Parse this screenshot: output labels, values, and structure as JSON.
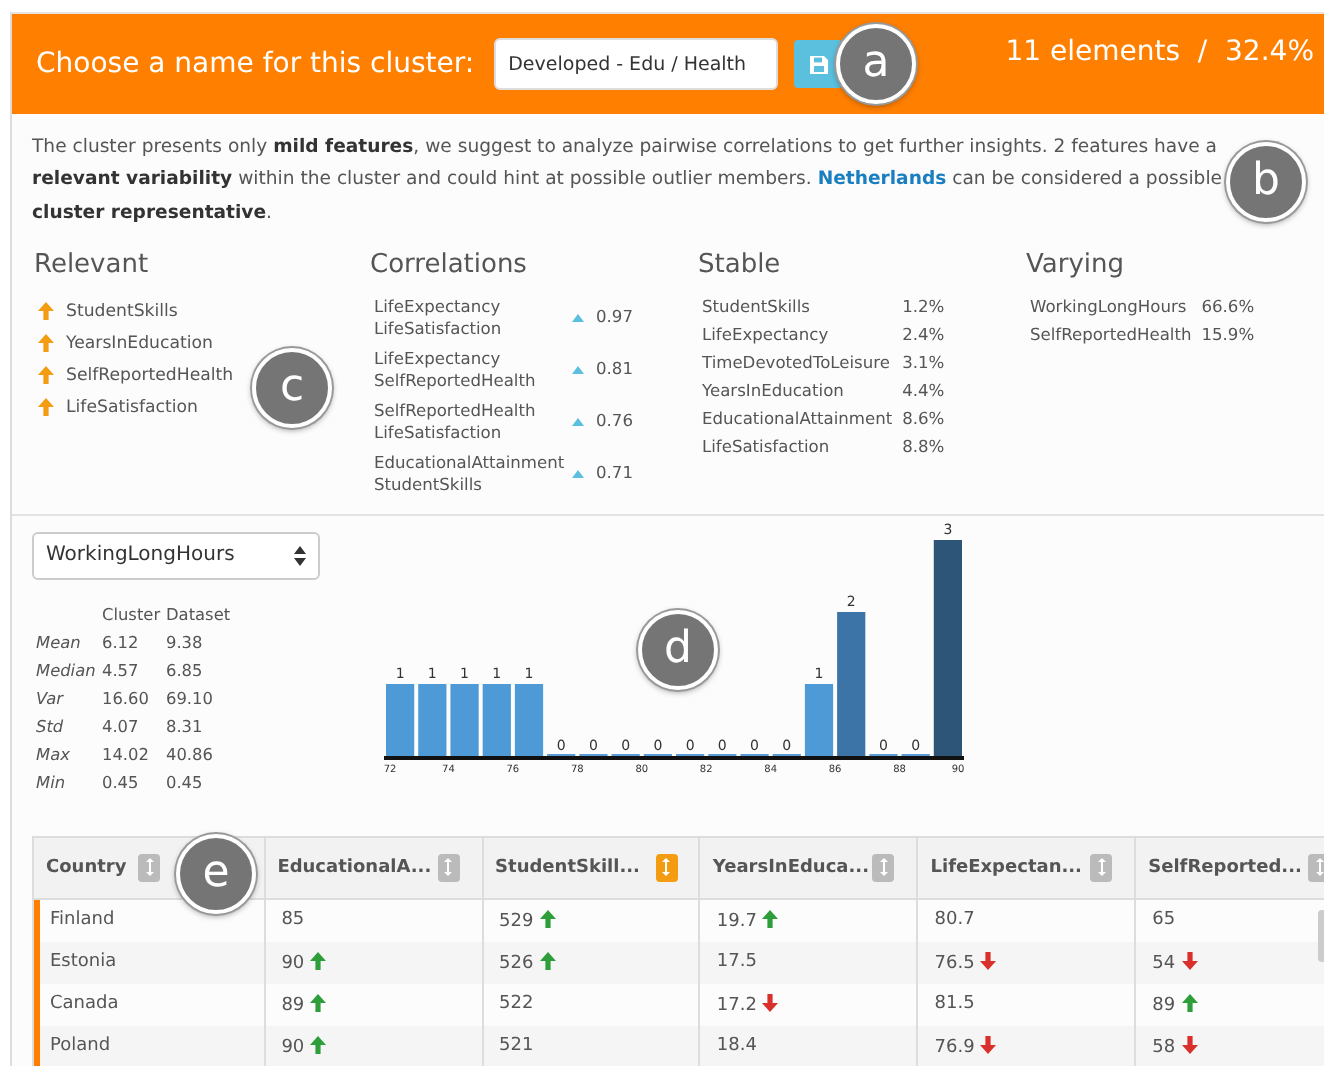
{
  "header": {
    "label": "Choose a name for this cluster:",
    "name_value": "Developed - Edu / Health",
    "summary": "11 elements  /  32.4%"
  },
  "description": [
    {
      "kind": "text",
      "text": "The cluster presents only **mild features**, we suggest to analyze pairwise correlations to get further insights. 2 features have a **relevant variability** within the cluster and could hint at possible outlier members."
    },
    {
      "kind": "link",
      "text": "Netherlands"
    },
    {
      "kind": "text",
      "text": "can be considered a possible **cluster representative**."
    }
  ],
  "relevant": {
    "title": "Relevant",
    "items": [
      "StudentSkills",
      "YearsInEducation",
      "SelfReportedHealth",
      "LifeSatisfaction"
    ]
  },
  "correlations": {
    "title": "Correlations",
    "items": [
      {
        "first": "LifeExpectancy",
        "second": "LifeSatisfaction",
        "value": "0.97"
      },
      {
        "first": "LifeExpectancy",
        "second": "SelfReportedHealth",
        "value": "0.81"
      },
      {
        "first": "SelfReportedHealth",
        "second": "LifeSatisfaction",
        "value": "0.76"
      },
      {
        "first": "EducationalAttainment",
        "second": "StudentSkills",
        "value": "0.71"
      }
    ]
  },
  "stable": {
    "title": "Stable",
    "items": [
      {
        "name": "StudentSkills",
        "value": "1.2%"
      },
      {
        "name": "LifeExpectancy",
        "value": "2.4%"
      },
      {
        "name": "TimeDevotedToLeisure",
        "value": "3.1%"
      },
      {
        "name": "YearsInEducation",
        "value": "4.4%"
      },
      {
        "name": "EducationalAttainment",
        "value": "8.6%"
      },
      {
        "name": "LifeSatisfaction",
        "value": "8.8%"
      }
    ]
  },
  "varying": {
    "title": "Varying",
    "items": [
      {
        "name": "WorkingLongHours",
        "value": "66.6%"
      },
      {
        "name": "SelfReportedHealth",
        "value": "15.9%"
      }
    ]
  },
  "feature_select": {
    "value": "WorkingLongHours"
  },
  "stats": {
    "columns": [
      "Cluster",
      "Dataset"
    ],
    "rows": [
      {
        "label": "Mean",
        "cluster": "6.12",
        "dataset": "9.38"
      },
      {
        "label": "Median",
        "cluster": "4.57",
        "dataset": "6.85"
      },
      {
        "label": "Var",
        "cluster": "16.60",
        "dataset": "69.10"
      },
      {
        "label": "Std",
        "cluster": "4.07",
        "dataset": "8.31"
      },
      {
        "label": "Max",
        "cluster": "14.02",
        "dataset": "40.86"
      },
      {
        "label": "Min",
        "cluster": "0.45",
        "dataset": "0.45"
      }
    ]
  },
  "histogram": {
    "chart_data": {
      "type": "bar",
      "x": [
        72.5,
        73.5,
        74.5,
        75.5,
        76.5,
        77.5,
        78.5,
        79.5,
        80.5,
        81.5,
        82.5,
        83.5,
        84.5,
        85.5,
        86.5,
        87.5,
        88.5,
        89.5
      ],
      "xlim": [
        72,
        90
      ],
      "values": [
        1,
        1,
        1,
        1,
        1,
        0,
        0,
        0,
        0,
        0,
        0,
        0,
        0,
        1,
        2,
        0,
        0,
        3
      ],
      "xticks": [
        72,
        74,
        76,
        78,
        80,
        82,
        84,
        86,
        88,
        90
      ],
      "data_labels": true
    }
  },
  "table": {
    "columns": [
      {
        "label": "Country",
        "sorted": false
      },
      {
        "label": "EducationalA...",
        "sorted": false
      },
      {
        "label": "StudentSkill...",
        "sorted": true
      },
      {
        "label": "YearsInEduca...",
        "sorted": false
      },
      {
        "label": "LifeExpectan...",
        "sorted": false
      },
      {
        "label": "SelfReported...",
        "sorted": false
      }
    ],
    "rows": [
      {
        "in_cluster": true,
        "cells": [
          {
            "text": "Finland"
          },
          {
            "text": "85"
          },
          {
            "text": "529",
            "increase": true
          },
          {
            "text": "19.7",
            "increase": true
          },
          {
            "text": "80.7"
          },
          {
            "text": "65"
          }
        ]
      },
      {
        "in_cluster": true,
        "cells": [
          {
            "text": "Estonia"
          },
          {
            "text": "90",
            "increase": true
          },
          {
            "text": "526",
            "increase": true
          },
          {
            "text": "17.5"
          },
          {
            "text": "76.5",
            "increase": false
          },
          {
            "text": "54",
            "increase": false
          }
        ]
      },
      {
        "in_cluster": true,
        "cells": [
          {
            "text": "Canada"
          },
          {
            "text": "89",
            "increase": true
          },
          {
            "text": "522"
          },
          {
            "text": "17.2",
            "increase": false
          },
          {
            "text": "81.5"
          },
          {
            "text": "89",
            "increase": true
          }
        ]
      },
      {
        "in_cluster": true,
        "cells": [
          {
            "text": "Poland"
          },
          {
            "text": "90",
            "increase": true
          },
          {
            "text": "521"
          },
          {
            "text": "18.4"
          },
          {
            "text": "76.9",
            "increase": false
          },
          {
            "text": "58",
            "increase": false
          }
        ]
      }
    ]
  },
  "callouts": [
    "a",
    "b",
    "c",
    "d",
    "e"
  ]
}
